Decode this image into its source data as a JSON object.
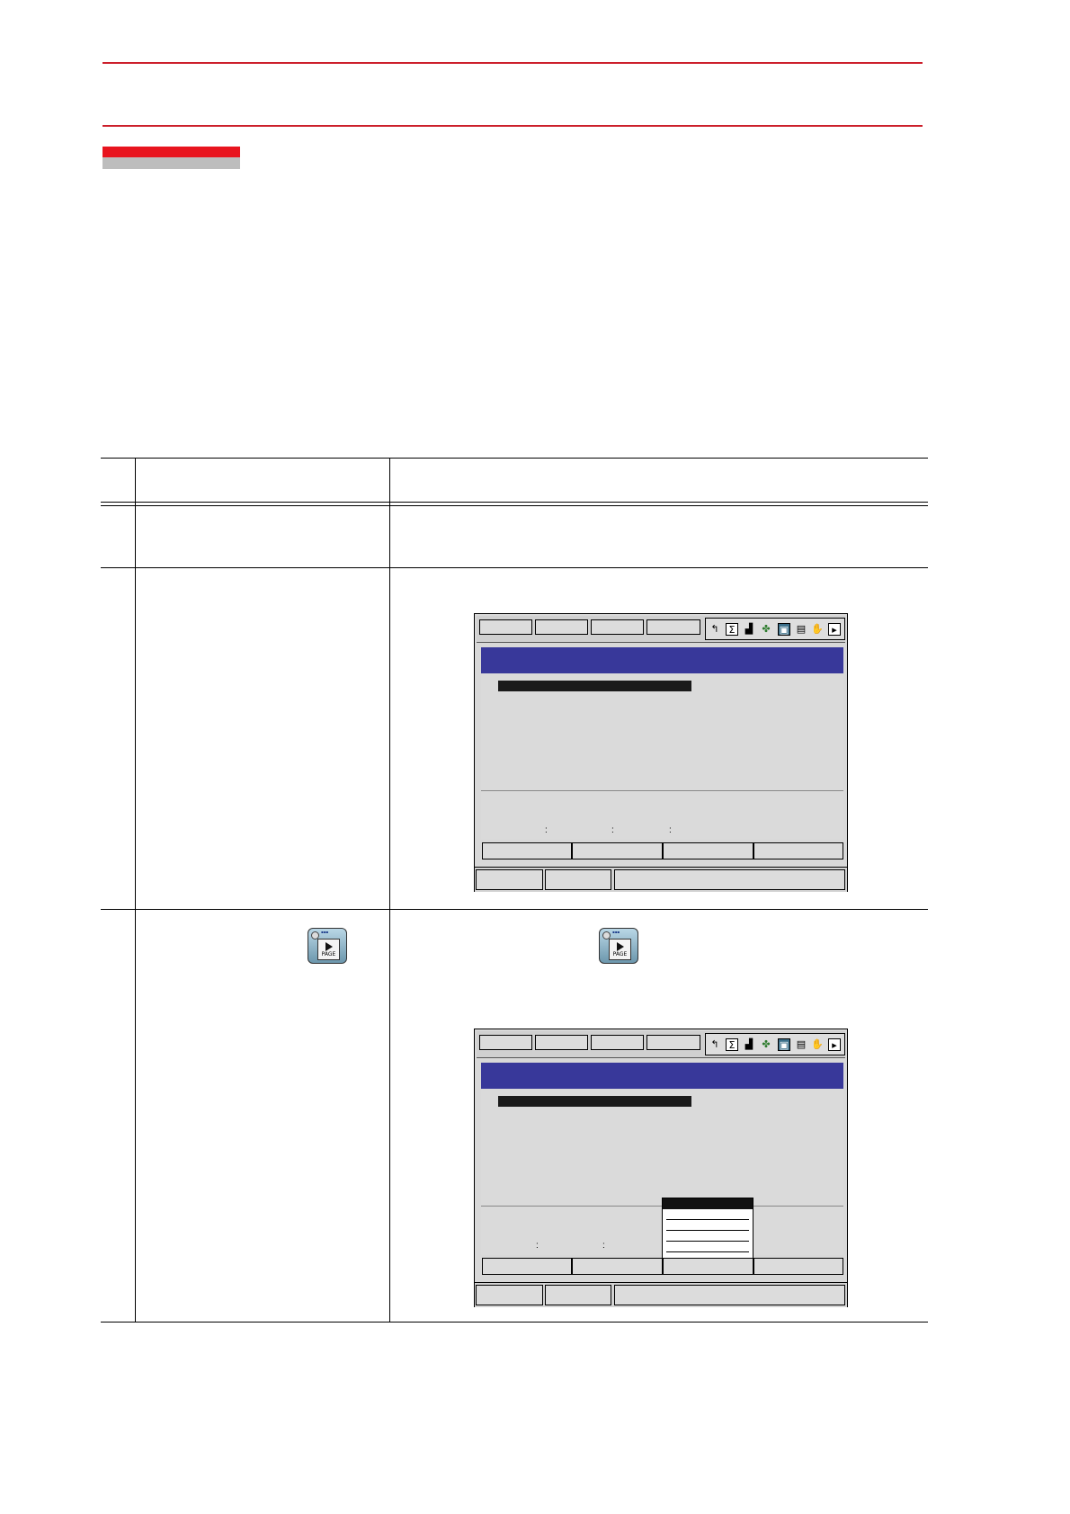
{
  "header": {
    "accent_color": "#cc1f2b"
  },
  "procedure_table": {
    "rows": [
      {
        "step": "",
        "operation": "",
        "explanation": ""
      },
      {
        "step": "",
        "operation": "",
        "explanation": ""
      },
      {
        "step": "",
        "operation": "",
        "explanation": ""
      }
    ]
  },
  "keys": {
    "page_key": {
      "icon": "page-key-icon",
      "label": "PAGE"
    }
  },
  "screens": [
    {
      "title": "",
      "has_pulldown": false
    },
    {
      "title": "",
      "has_pulldown": true
    }
  ],
  "colors": {
    "title_bar": "#38389a",
    "screen_bg": "#d8d8d8"
  }
}
